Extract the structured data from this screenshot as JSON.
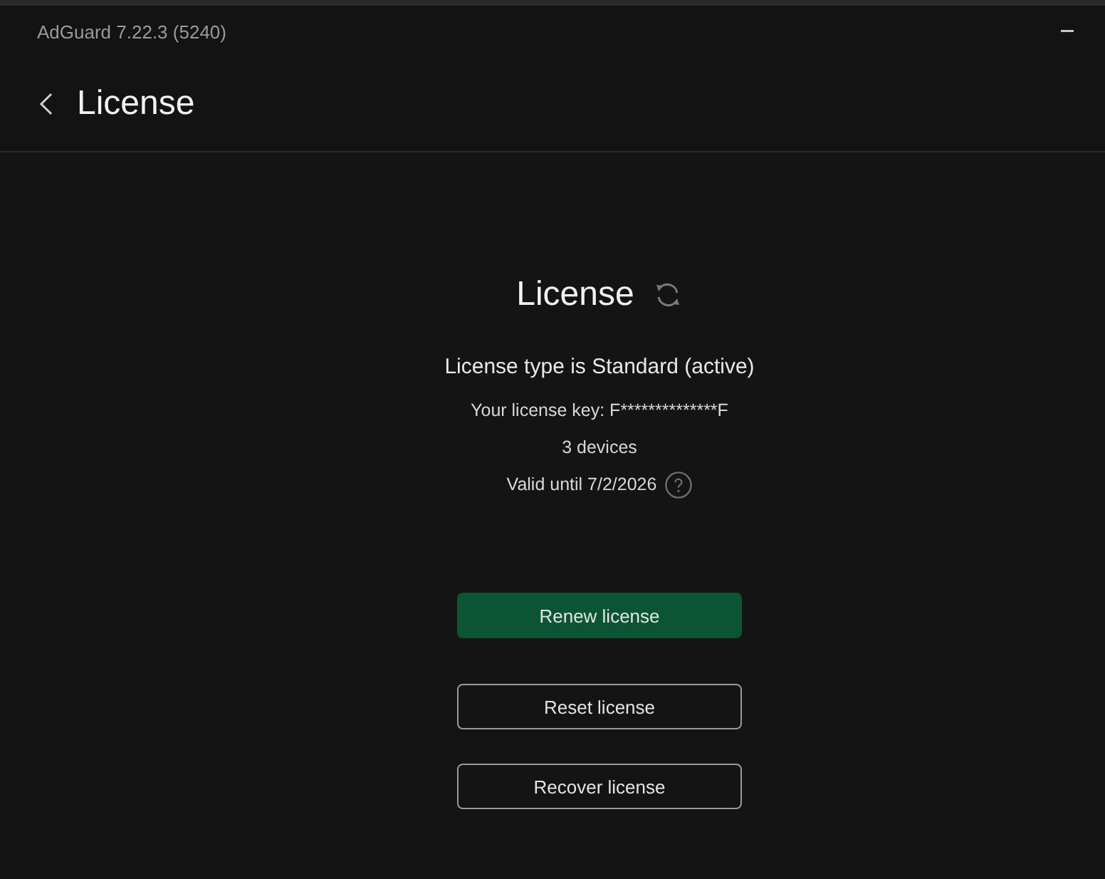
{
  "window": {
    "title": "AdGuard 7.22.3 (5240)"
  },
  "header": {
    "title": "License"
  },
  "license": {
    "title": "License",
    "type_line": "License type is Standard (active)",
    "key_line": "Your license key: F**************F",
    "devices": "3 devices",
    "valid_until": "Valid until 7/2/2026"
  },
  "buttons": [
    {
      "label": "Renew license",
      "kind": "primary"
    },
    {
      "label": "Reset license",
      "kind": "outline"
    },
    {
      "label": "Recover license",
      "kind": "outline"
    }
  ]
}
